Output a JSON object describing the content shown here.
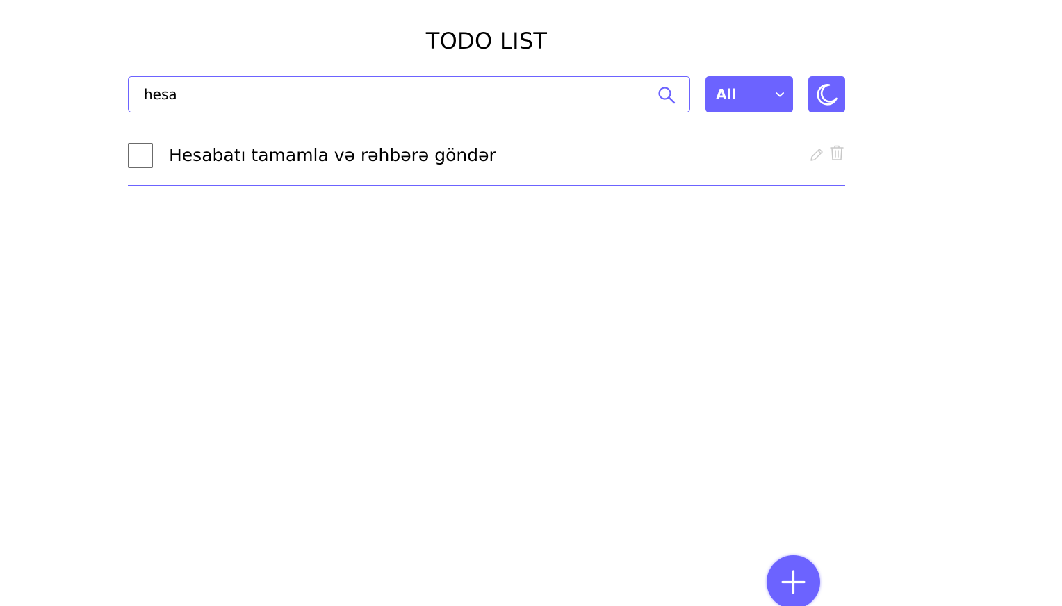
{
  "header": {
    "title": "TODO LIST"
  },
  "search": {
    "value": "hesa",
    "icon": "search-icon"
  },
  "filter": {
    "selected": "All",
    "icon": "chevron-down-icon"
  },
  "theme_toggle": {
    "icon": "moon-icon"
  },
  "todos": [
    {
      "text": "Hesabatı tamamla və rəhbərə göndər",
      "checked": false
    }
  ],
  "add_button": {
    "icon": "plus-icon"
  },
  "colors": {
    "accent": "#6c63ff",
    "icon_muted": "#c8c8c8",
    "text": "#000000",
    "background": "#ffffff"
  }
}
